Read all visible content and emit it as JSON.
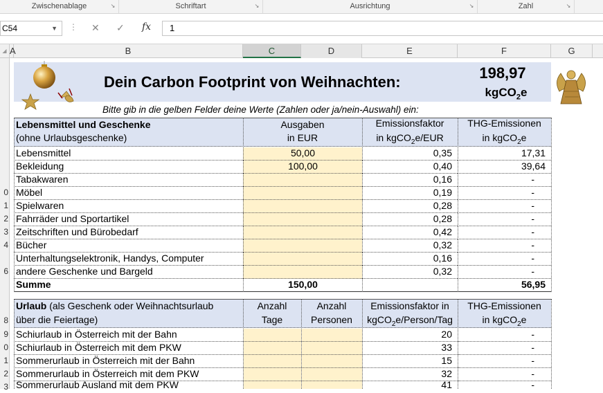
{
  "ribbon": {
    "groups": [
      "Zwischenablage",
      "Schriftart",
      "Ausrichtung",
      "Zahl"
    ]
  },
  "formula_bar": {
    "name_box": "C54",
    "fx_label": "fx",
    "value": "1"
  },
  "columns": [
    "A",
    "B",
    "C",
    "D",
    "E",
    "F",
    "G"
  ],
  "rows": [
    "",
    "",
    "",
    "",
    "",
    "",
    "",
    "",
    "0",
    "1",
    "2",
    "3",
    "4",
    "5",
    "6",
    "",
    "",
    "8",
    "9",
    "0",
    "1",
    "2",
    "3"
  ],
  "title": {
    "main": "Dein Carbon Footprint von Weihnachten:",
    "total_value": "198,97",
    "total_unit_prefix": "kgCO",
    "total_unit_sub": "2",
    "total_unit_suffix": "e",
    "instruction": "Bitte gib in die gelben Felder deine Werte (Zahlen oder ja/nein-Auswahl) ein:"
  },
  "section1": {
    "header_title": "Lebensmittel und Geschenke",
    "header_subtitle": "(ohne Urlaubsgeschenke)",
    "col_ausgaben_1": "Ausgaben",
    "col_ausgaben_2": "in EUR",
    "col_faktor_1": "Emissionsfaktor",
    "col_faktor_2a": "in kgCO",
    "col_faktor_2sub": "2",
    "col_faktor_2b": "e/EUR",
    "col_thg_1": "THG-Emissionen",
    "col_thg_2a": "in kgCO",
    "col_thg_2sub": "2",
    "col_thg_2b": "e",
    "rows": [
      {
        "label": "Lebensmittel",
        "ausgaben": "50,00",
        "faktor": "0,35",
        "thg": "17,31"
      },
      {
        "label": "Bekleidung",
        "ausgaben": "100,00",
        "faktor": "0,40",
        "thg": "39,64"
      },
      {
        "label": "Tabakwaren",
        "ausgaben": "",
        "faktor": "0,16",
        "thg": "-"
      },
      {
        "label": "Möbel",
        "ausgaben": "",
        "faktor": "0,19",
        "thg": "-"
      },
      {
        "label": "Spielwaren",
        "ausgaben": "",
        "faktor": "0,28",
        "thg": "-"
      },
      {
        "label": "Fahrräder und Sportartikel",
        "ausgaben": "",
        "faktor": "0,28",
        "thg": "-"
      },
      {
        "label": "Zeitschriften und Bürobedarf",
        "ausgaben": "",
        "faktor": "0,42",
        "thg": "-"
      },
      {
        "label": "Bücher",
        "ausgaben": "",
        "faktor": "0,32",
        "thg": "-"
      },
      {
        "label": "Unterhaltungselektronik, Handys, Computer",
        "ausgaben": "",
        "faktor": "0,16",
        "thg": "-"
      },
      {
        "label": "andere Geschenke und Bargeld",
        "ausgaben": "",
        "faktor": "0,32",
        "thg": "-"
      }
    ],
    "sum_label": "Summe",
    "sum_ausgaben": "150,00",
    "sum_thg": "56,95"
  },
  "section2": {
    "header_title": "Urlaub",
    "header_title_rest": " (als Geschenk oder Weihnachtsurlaub",
    "header_subtitle": "über die Feiertage)",
    "col_tage_1": "Anzahl",
    "col_tage_2": "Tage",
    "col_personen_1": "Anzahl",
    "col_personen_2": "Personen",
    "col_faktor_1": "Emissionsfaktor in",
    "col_faktor_2a": "kgCO",
    "col_faktor_2sub": "2",
    "col_faktor_2b": "e/Person/Tag",
    "col_thg_1": "THG-Emissionen",
    "col_thg_2a": "in kgCO",
    "col_thg_2sub": "2",
    "col_thg_2b": "e",
    "rows": [
      {
        "label": "Schiurlaub in Österreich mit der Bahn",
        "faktor": "20",
        "thg": "-"
      },
      {
        "label": "Schiurlaub in Österreich mit dem PKW",
        "faktor": "33",
        "thg": "-"
      },
      {
        "label": "Sommerurlaub in Österreich mit der Bahn",
        "faktor": "15",
        "thg": "-"
      },
      {
        "label": "Sommerurlaub in Österreich mit dem PKW",
        "faktor": "32",
        "thg": "-"
      },
      {
        "label": "Sommerurlaub Ausland mit dem PKW",
        "faktor": "41",
        "thg": "-"
      }
    ]
  },
  "colors": {
    "header_fill": "#dce3f2",
    "input_fill": "#fff2cc",
    "excel_green": "#217346"
  }
}
